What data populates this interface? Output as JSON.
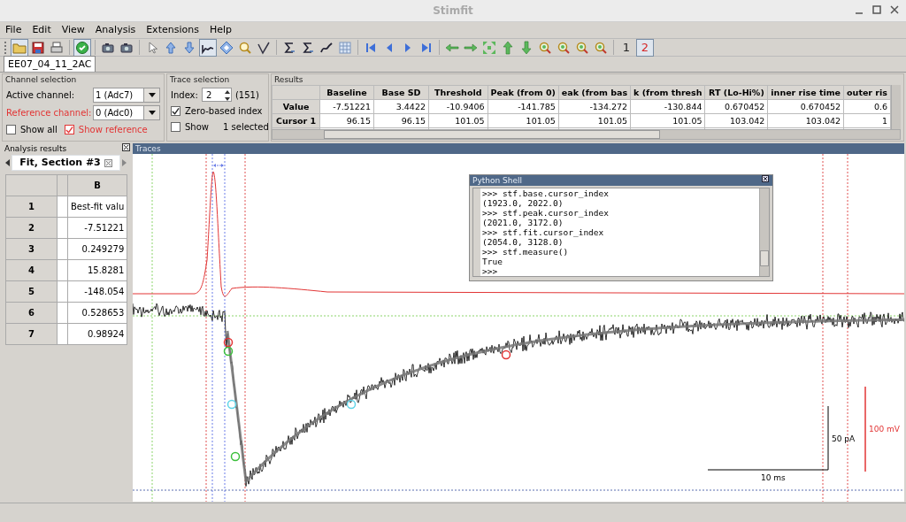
{
  "window": {
    "title": "Stimfit"
  },
  "menu": [
    "File",
    "Edit",
    "View",
    "Analysis",
    "Extensions",
    "Help"
  ],
  "toolbar": [
    {
      "kind": "grip"
    },
    {
      "kind": "open",
      "pressed": true
    },
    {
      "kind": "save",
      "pressed": false
    },
    {
      "kind": "print",
      "pressed": false
    },
    {
      "kind": "separator"
    },
    {
      "kind": "apply",
      "pressed": true
    },
    {
      "kind": "separator"
    },
    {
      "kind": "camera",
      "pressed": false
    },
    {
      "kind": "camera",
      "pressed": false
    },
    {
      "kind": "separator"
    },
    {
      "kind": "pointer",
      "pressed": false
    },
    {
      "kind": "up",
      "pressed": false
    },
    {
      "kind": "down",
      "pressed": false
    },
    {
      "kind": "waveform",
      "pressed": true
    },
    {
      "kind": "diamond",
      "pressed": false
    },
    {
      "kind": "zoom",
      "pressed": false
    },
    {
      "kind": "vcheck",
      "pressed": false
    },
    {
      "kind": "separator"
    },
    {
      "kind": "sigma",
      "pressed": false
    },
    {
      "kind": "sigma",
      "pressed": false
    },
    {
      "kind": "curve",
      "pressed": false
    },
    {
      "kind": "table",
      "pressed": false
    },
    {
      "kind": "separator"
    },
    {
      "kind": "first",
      "pressed": false
    },
    {
      "kind": "prev",
      "pressed": false
    },
    {
      "kind": "next",
      "pressed": false
    },
    {
      "kind": "last",
      "pressed": false
    },
    {
      "kind": "separator"
    },
    {
      "kind": "left",
      "pressed": false
    },
    {
      "kind": "right",
      "pressed": false
    },
    {
      "kind": "fit",
      "pressed": false
    },
    {
      "kind": "gup",
      "pressed": false
    },
    {
      "kind": "gdown",
      "pressed": false
    },
    {
      "kind": "gzoom",
      "pressed": false
    },
    {
      "kind": "gzoom",
      "pressed": false
    },
    {
      "kind": "gzoom",
      "pressed": false
    },
    {
      "kind": "gzoom",
      "pressed": false
    },
    {
      "kind": "separator"
    },
    {
      "kind": "text",
      "label": "1",
      "pressed": false
    },
    {
      "kind": "text",
      "label": "2",
      "pressed": true
    }
  ],
  "document_tab": "EE07_04_11_2AC",
  "channel_selection": {
    "title": "Channel selection",
    "active_label": "Active channel:",
    "active_value": "1 (Adc7)",
    "reference_label": "Reference channel:",
    "reference_value": "0 (Adc0)",
    "show_all": {
      "label": "Show all",
      "checked": false
    },
    "show_reference": {
      "label": "Show reference",
      "checked": true
    }
  },
  "trace_selection": {
    "title": "Trace selection",
    "index_label": "Index:",
    "index_value": "2",
    "count": "(151)",
    "zero_based": {
      "label": "Zero-based index",
      "checked": true
    },
    "show": {
      "label": "Show",
      "checked": false
    },
    "selected_text": "1 selected"
  },
  "results": {
    "title": "Results",
    "columns": [
      "Baseline",
      "Base SD",
      "Threshold",
      "Peak (from 0)",
      "eak (from bas",
      "k (from thresh",
      "RT (Lo-Hi%)",
      "inner rise time",
      "outer ris"
    ],
    "rows": [
      {
        "header": "Value",
        "cells": [
          "-7.51221",
          "3.4422",
          "-10.9406",
          "-141.785",
          "-134.272",
          "-130.844",
          "0.670452",
          "0.670452",
          "0.6"
        ]
      },
      {
        "header": "Cursor 1",
        "cells": [
          "96.15",
          "96.15",
          "101.05",
          "101.05",
          "101.05",
          "101.05",
          "103.042",
          "103.042",
          "1"
        ]
      }
    ]
  },
  "analysis_results": {
    "title": "Analysis results",
    "tab": "Fit, Section #3",
    "column": "B",
    "rows": [
      {
        "number": "1",
        "value": "Best-fit valu"
      },
      {
        "number": "2",
        "value": "-7.51221"
      },
      {
        "number": "3",
        "value": "0.249279"
      },
      {
        "number": "4",
        "value": "15.8281"
      },
      {
        "number": "5",
        "value": "-148.054"
      },
      {
        "number": "6",
        "value": "0.528653"
      },
      {
        "number": "7",
        "value": "0.98924"
      }
    ]
  },
  "traces": {
    "title": "Traces",
    "y_scale": "50 pA",
    "x_scale": "10 ms",
    "reference_scale": "100 mV"
  },
  "python_shell": {
    "title": "Python Shell",
    "lines": [
      ">>> stf.base.cursor_index",
      "(1923.0, 2022.0)",
      ">>> stf.peak.cursor_index",
      "(2021.0, 3172.0)",
      ">>> stf.fit.cursor_index",
      "(2054.0, 3128.0)",
      ">>> stf.measure()",
      "True",
      ">>>"
    ]
  }
}
